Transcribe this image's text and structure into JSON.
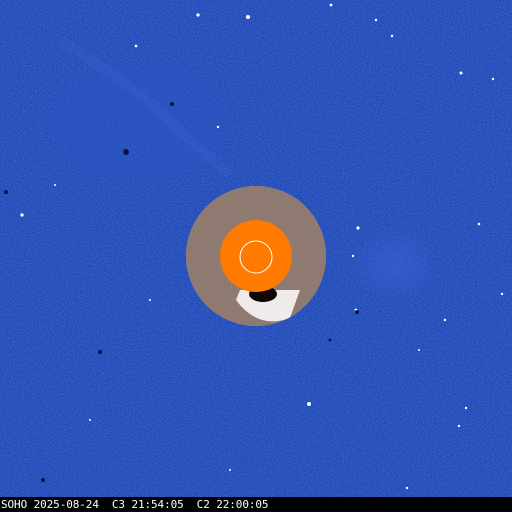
{
  "caption": {
    "text": "SOHO 2025-08-24  C3 21:54:05  C2 22:00:05"
  },
  "colors": {
    "sky": "#1f47b8",
    "sky_dark": "#143a9e",
    "sun_disk": "#ff7a00",
    "sun_outline": "#ffffff",
    "occulter_light": "#ffffff",
    "occulter_dark": "#2a1408"
  }
}
